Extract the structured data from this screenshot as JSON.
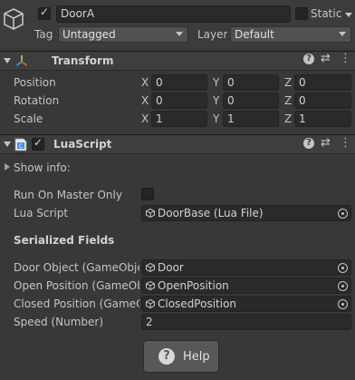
{
  "object_header": {
    "enabled": true,
    "name": "DoorA",
    "static_label": "Static",
    "static_checked": false,
    "tag_label": "Tag",
    "tag_value": "Untagged",
    "layer_label": "Layer",
    "layer_value": "Default"
  },
  "transform": {
    "title": "Transform",
    "rows": [
      {
        "label": "Position",
        "x": "0",
        "y": "0",
        "z": "0"
      },
      {
        "label": "Rotation",
        "x": "0",
        "y": "0",
        "z": "0"
      },
      {
        "label": "Scale",
        "x": "1",
        "y": "1",
        "z": "1"
      }
    ],
    "axis_labels": {
      "x": "X",
      "y": "Y",
      "z": "Z"
    }
  },
  "lua_script": {
    "enabled": true,
    "title": "LuaScript",
    "show_info_label": "Show info:",
    "run_on_master_label": "Run On Master Only",
    "run_on_master_checked": false,
    "lua_script_label": "Lua Script",
    "lua_script_value": "DoorBase (Lua File)",
    "serialized_fields_heading": "Serialized Fields",
    "fields": [
      {
        "label": "Door Object (GameObject)",
        "value": "Door"
      },
      {
        "label": "Open Position (GameObject)",
        "value": "OpenPosition"
      },
      {
        "label": "Closed Position (GameObject)",
        "value": "ClosedPosition"
      }
    ],
    "speed_label": "Speed (Number)",
    "speed_value": "2",
    "help_button_label": "Help"
  },
  "icons": {
    "object": "cube-icon",
    "transform": "transform-axes-icon",
    "script": "lua-script-icon",
    "help": "question-circle-icon",
    "settings": "sliders-icon",
    "menu": "kebab-menu-icon",
    "foldout": "triangle-down-icon",
    "picker": "object-picker-icon"
  },
  "colors": {
    "background": "#383838",
    "field": "#2a2a2a",
    "header": "#3e3e3e",
    "accent_blue": "#4a8fe0"
  }
}
